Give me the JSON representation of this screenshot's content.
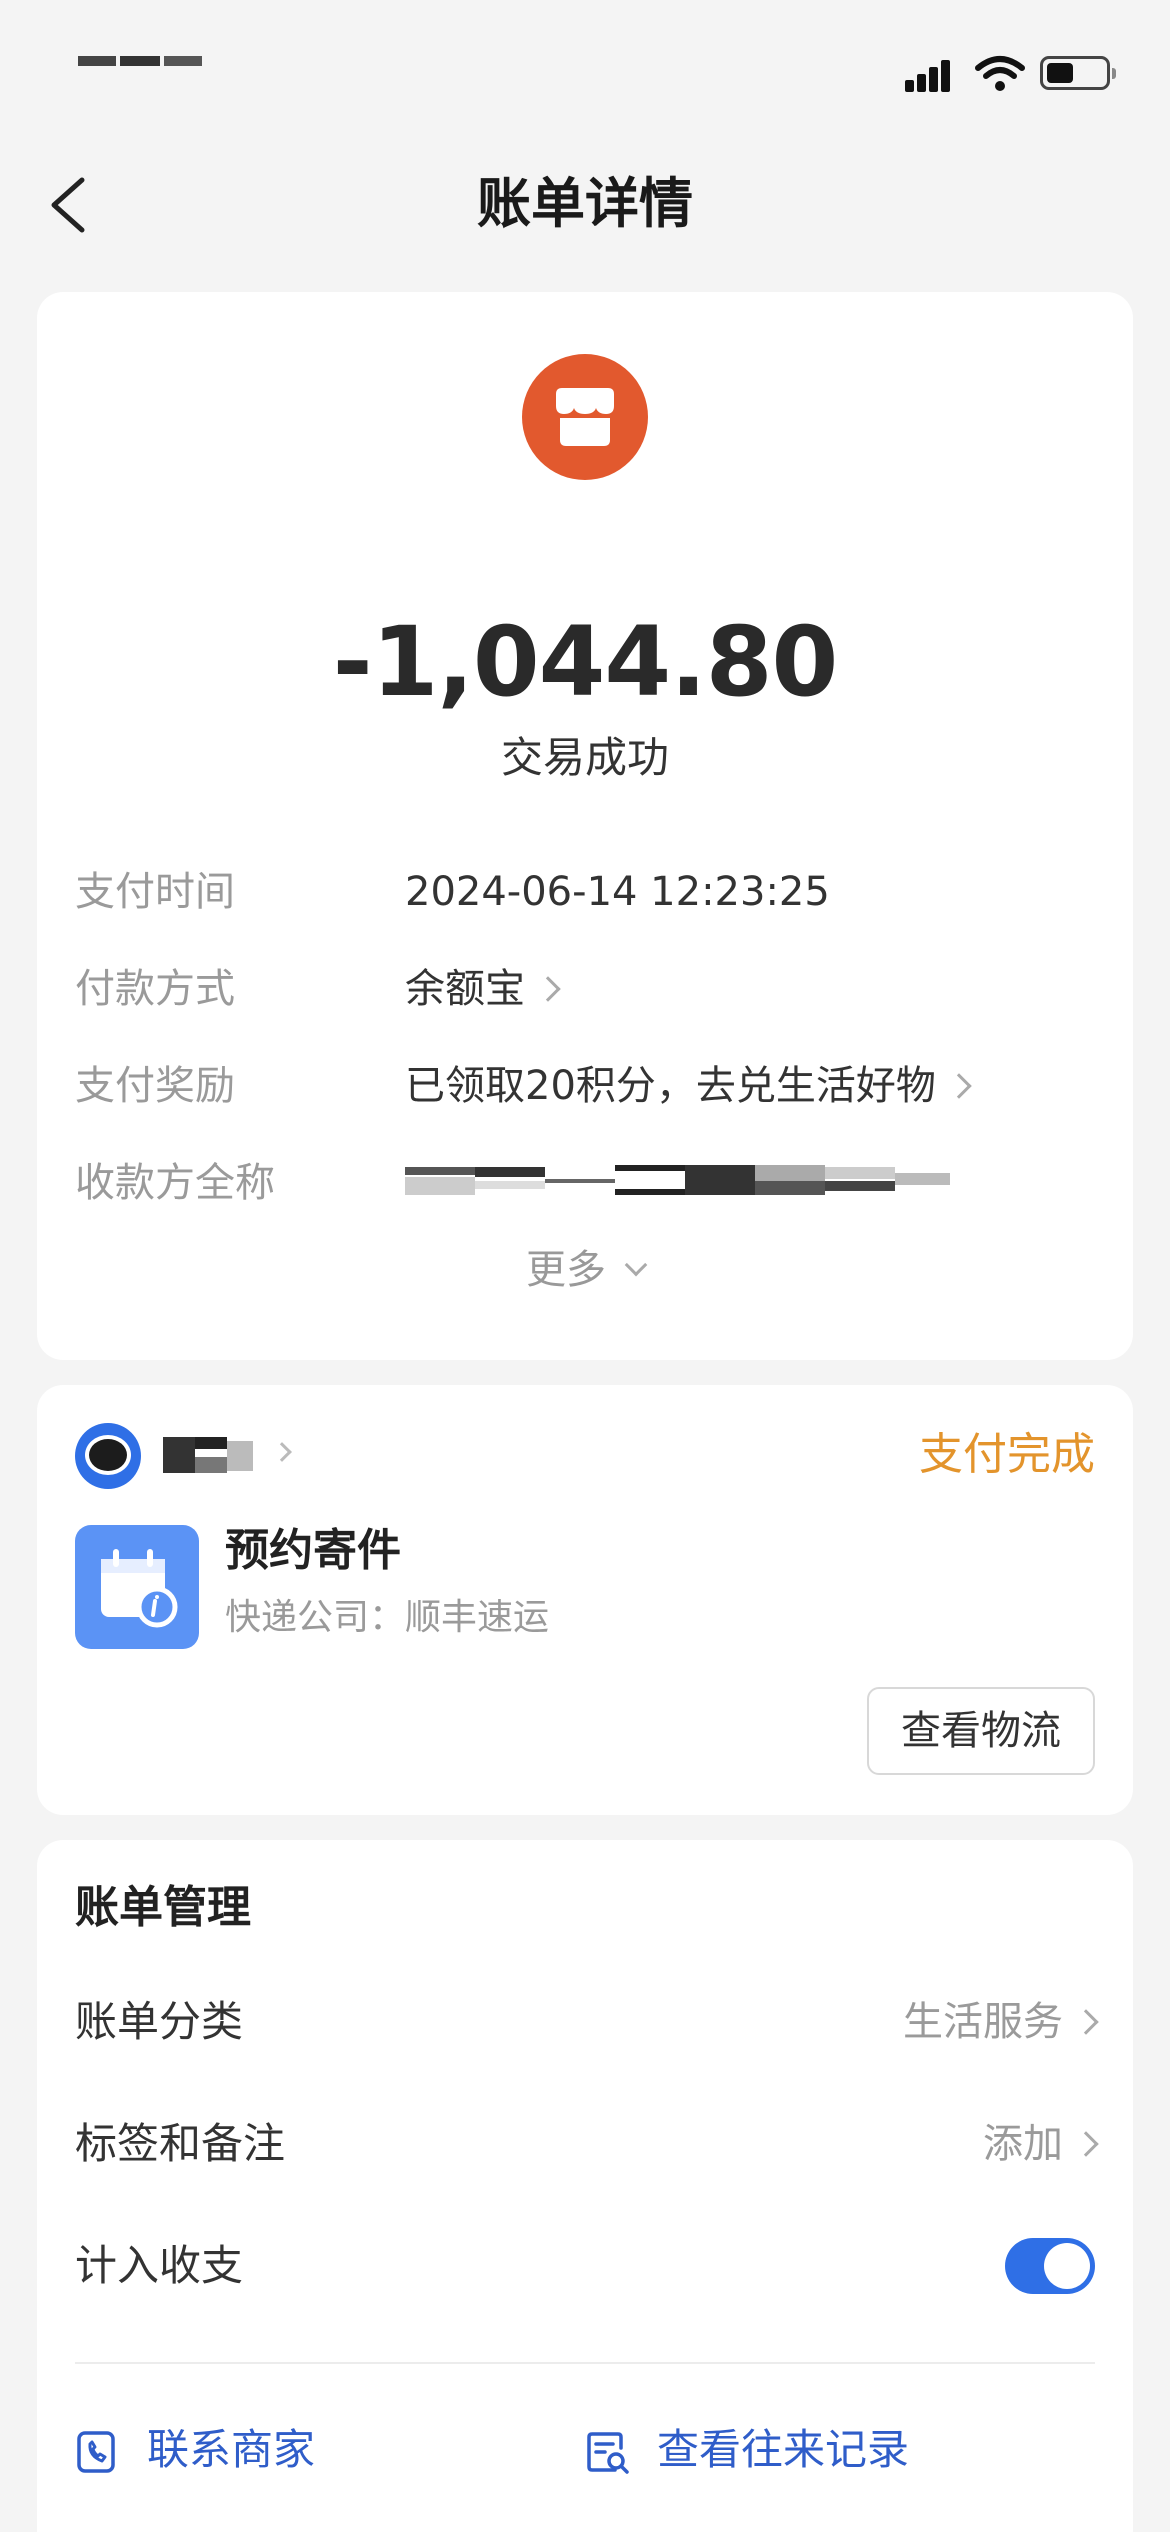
{
  "nav": {
    "title": "账单详情"
  },
  "transaction": {
    "amount": "-1,044.80",
    "status": "交易成功"
  },
  "details": {
    "rows": [
      {
        "label": "支付时间",
        "value": "2024-06-14 12:23:25"
      },
      {
        "label": "付款方式",
        "value": "余额宝"
      },
      {
        "label": "支付奖励",
        "value": "已领取20积分，去兑生活好物"
      },
      {
        "label": "收款方全称",
        "value": ""
      }
    ],
    "more_label": "更多"
  },
  "order": {
    "status": "支付完成",
    "service_title": "预约寄件",
    "service_subtitle": "快递公司：顺丰速运",
    "logistics_button": "查看物流"
  },
  "management": {
    "title": "账单管理",
    "category_label": "账单分类",
    "category_value": "生活服务",
    "tags_label": "标签和备注",
    "tags_value": "添加",
    "include_label": "计入收支",
    "include_enabled": true,
    "contact_label": "联系商家",
    "history_label": "查看往来记录"
  },
  "colors": {
    "merchant_icon": "#e2592e",
    "pay_done": "#e3942c",
    "accent_blue": "#2f6fe6",
    "service_icon": "#5b93f5"
  },
  "icons": {
    "back": "chevron-left-icon",
    "merchant": "store-icon",
    "service": "calendar-icon",
    "contact": "phone-icon",
    "history": "document-search-icon"
  }
}
